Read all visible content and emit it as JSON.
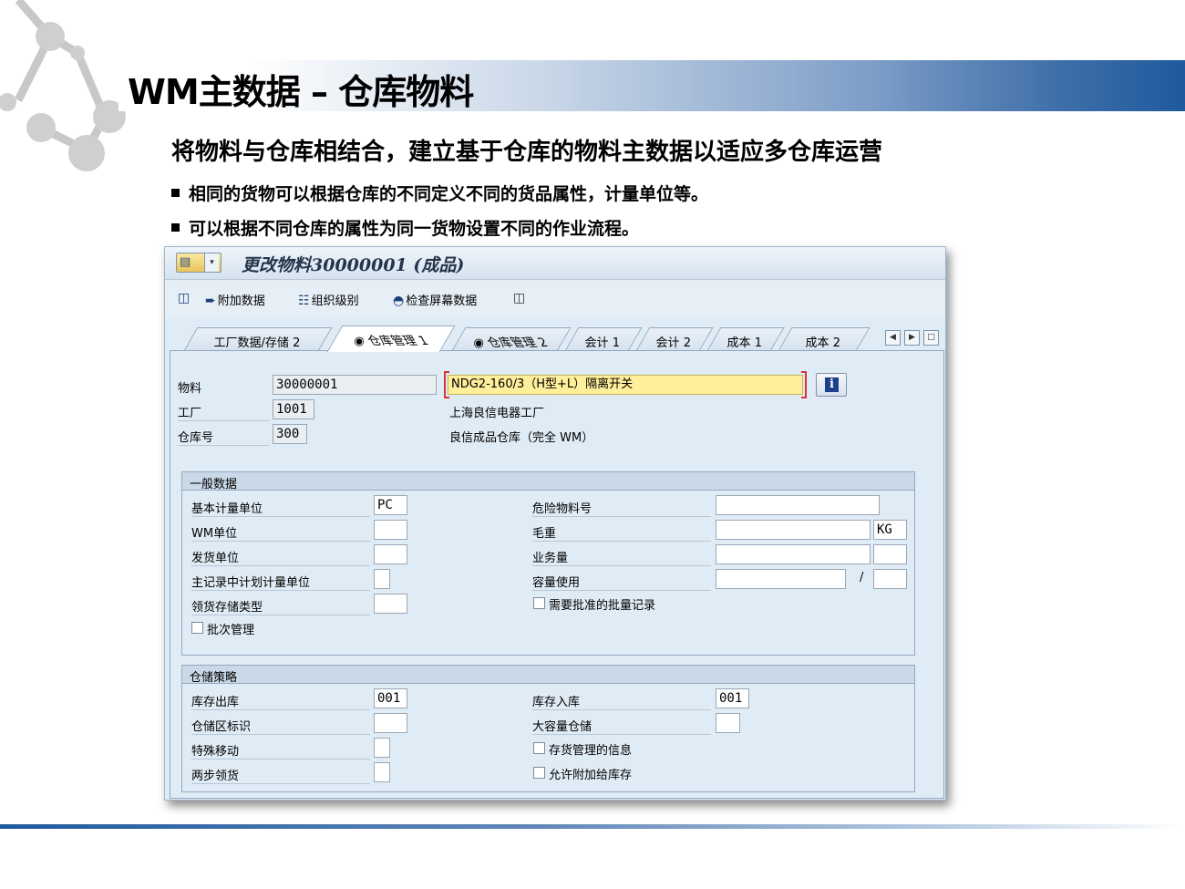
{
  "slide": {
    "title": "WM主数据 – 仓库物料",
    "subtitle": "将物料与仓库相结合，建立基于仓库的物料主数据以适应多仓库运营",
    "bullets": [
      "相同的货物可以根据仓库的不同定义不同的货品属性，计量单位等。",
      "可以根据不同仓库的属性为同一货物设置不同的作业流程。"
    ]
  },
  "sap": {
    "title": "更改物料30000001 (成品)",
    "toolbar": {
      "additional_data": "附加数据",
      "org_levels": "组织级别",
      "check_screen": "检查屏幕数据"
    },
    "tabs": [
      "工厂数据/存储 2",
      "仓库管理 1",
      "仓库管理 2",
      "会计 1",
      "会计 2",
      "成本 1",
      "成本 2"
    ],
    "active_tab": "仓库管理 1",
    "header": {
      "material_label": "物料",
      "material_value": "30000001",
      "material_desc": "NDG2-160/3（H型+L）隔离开关",
      "plant_label": "工厂",
      "plant_value": "1001",
      "plant_desc": "上海良信电器工厂",
      "warehouse_label": "仓库号",
      "warehouse_value": "300",
      "warehouse_desc": "良信成品仓库（完全 WM）"
    },
    "general": {
      "title": "一般数据",
      "base_uom_label": "基本计量单位",
      "base_uom_value": "PC",
      "wm_unit_label": "WM单位",
      "issue_unit_label": "发货单位",
      "planned_unit_label": "主记录中计划计量单位",
      "pick_storage_type_label": "领货存储类型",
      "batch_mgmt_label": "批次管理",
      "hazmat_label": "危险物料号",
      "gross_weight_label": "毛重",
      "gross_weight_unit": "KG",
      "volume_label": "业务量",
      "capacity_label": "容量使用",
      "capacity_sep": "/",
      "approved_batch_label": "需要批准的批量记录"
    },
    "strategy": {
      "title": "仓储策略",
      "removal_label": "库存出库",
      "removal_value": "001",
      "placement_label": "库存入库",
      "placement_value": "001",
      "section_label": "仓储区标识",
      "bulk_label": "大容量仓储",
      "special_move_label": "特殊移动",
      "two_step_label": "两步领货",
      "stock_mgmt_label": "存货管理的信息",
      "allow_addition_label": "允许附加给库存"
    }
  }
}
